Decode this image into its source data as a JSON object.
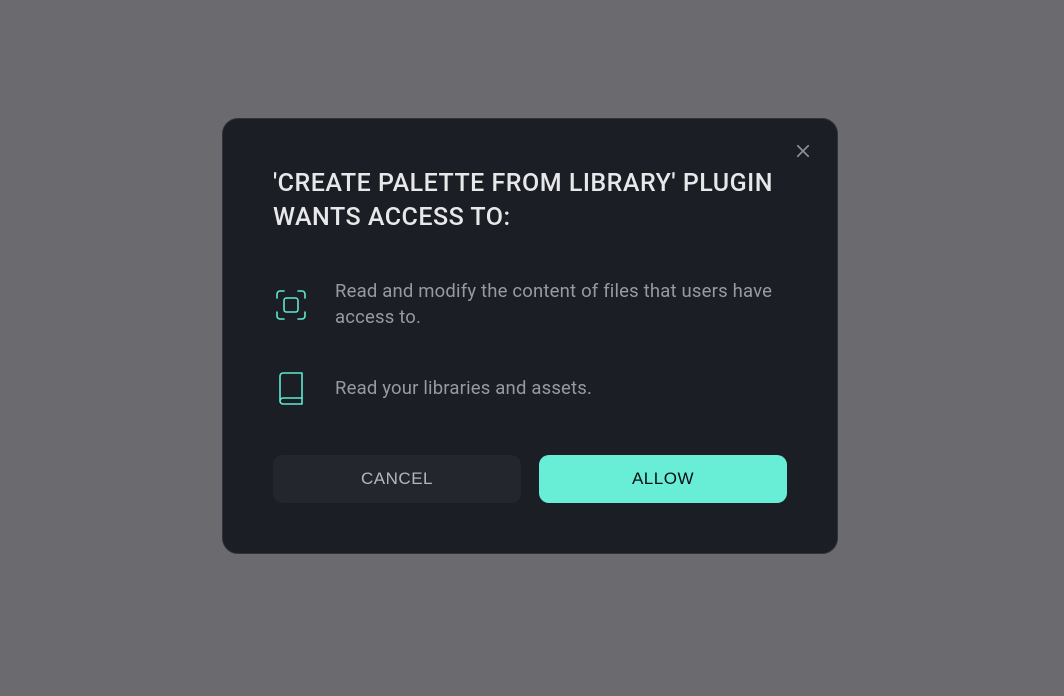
{
  "dialog": {
    "title": "'CREATE PALETTE FROM LIBRARY' PLUGIN WANTS ACCESS TO:",
    "permissions": [
      {
        "icon": "scan-content-icon",
        "text": "Read and modify the content of files that users have access to."
      },
      {
        "icon": "book-icon",
        "text": "Read your libraries and assets."
      }
    ],
    "cancel_label": "CANCEL",
    "allow_label": "ALLOW"
  },
  "colors": {
    "accent": "#68eed6",
    "dialog_bg": "#1b1e24",
    "backdrop": "#6b6b6f"
  }
}
